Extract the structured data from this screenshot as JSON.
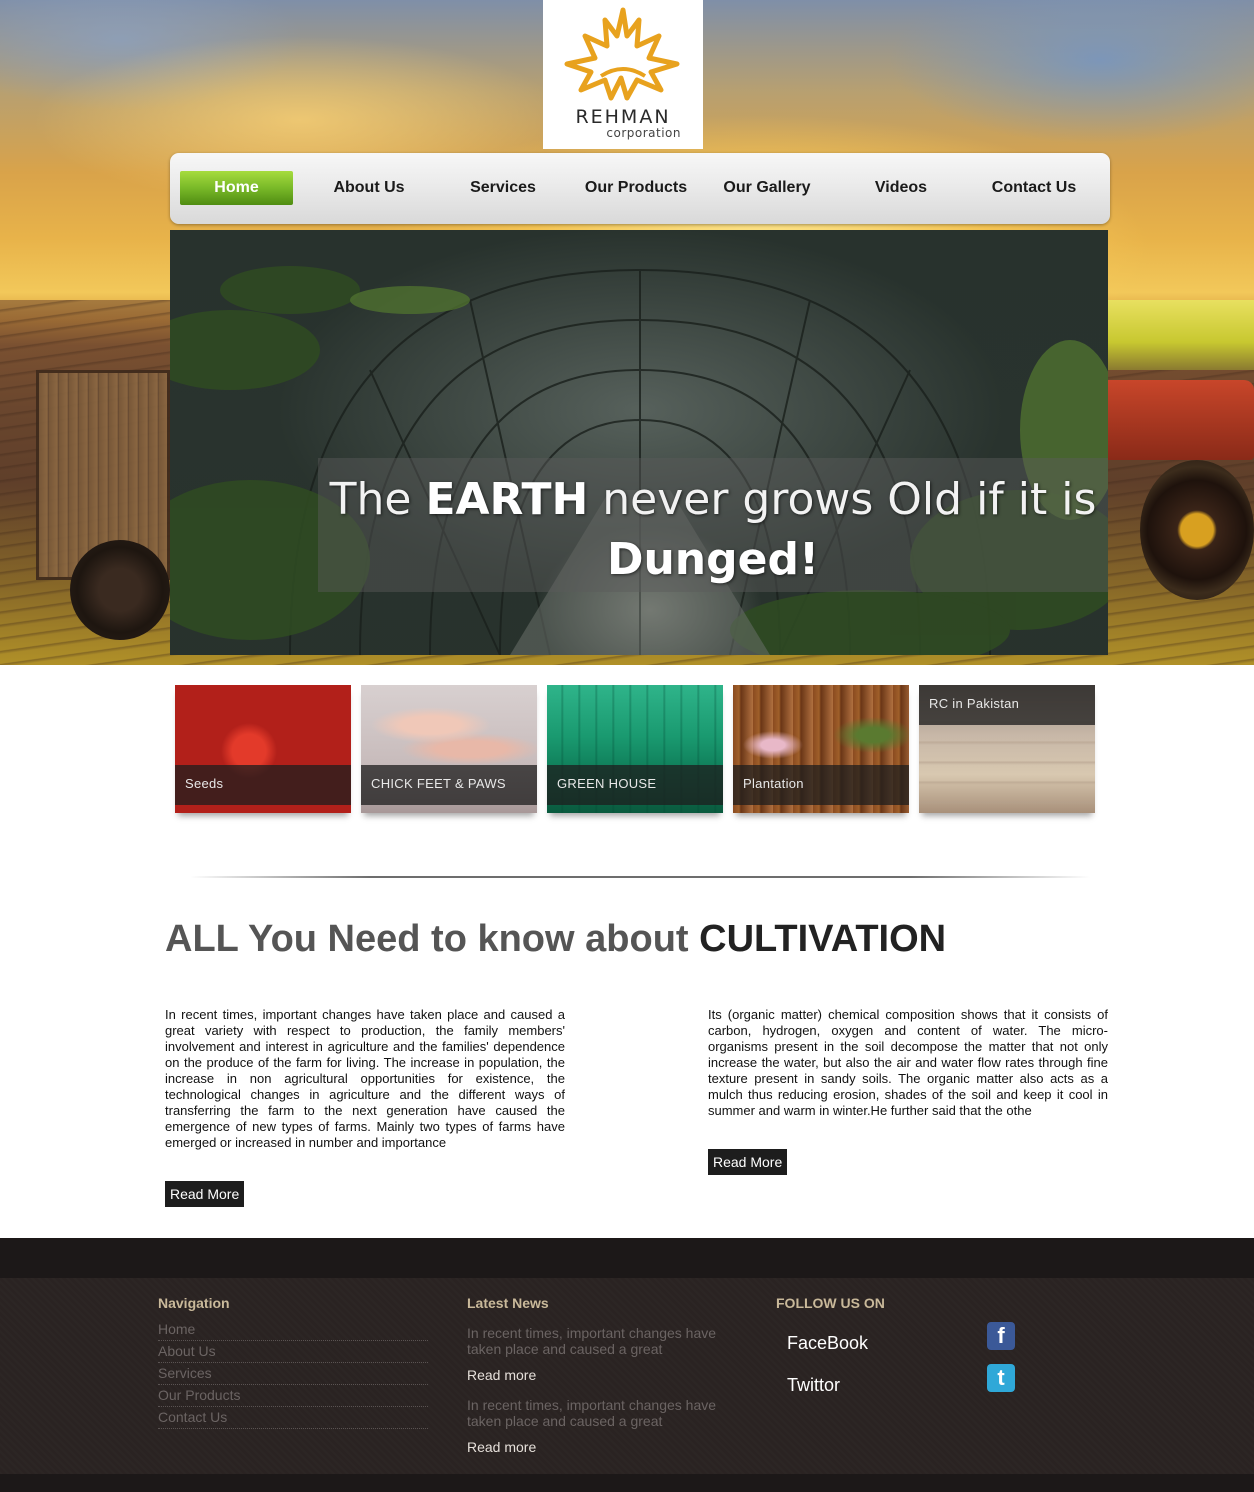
{
  "brand": {
    "name": "REHMAN",
    "tagline": "corporation",
    "colors": {
      "logo": "#e8a21e",
      "nav_active": "#79b928",
      "footer_bg": "#2a2322"
    }
  },
  "nav": {
    "items": [
      {
        "label": "Home",
        "active": true
      },
      {
        "label": "About Us",
        "active": false
      },
      {
        "label": "Services",
        "active": false
      },
      {
        "label": "Our Products",
        "active": false
      },
      {
        "label": "Our Gallery",
        "active": false
      },
      {
        "label": "Videos",
        "active": false
      },
      {
        "label": "Contact Us",
        "active": false
      }
    ]
  },
  "banner": {
    "caption_part1": "The ",
    "caption_bold1": "EARTH",
    "caption_part2": " never grows Old if it is ",
    "caption_bold2": "Dunged!"
  },
  "thumbs": [
    {
      "label": "Seeds"
    },
    {
      "label": "CHICK FEET & PAWS"
    },
    {
      "label": "GREEN HOUSE"
    },
    {
      "label": "Plantation"
    },
    {
      "label": "RC in Pakistan"
    }
  ],
  "main": {
    "heading_light": "ALL You Need to know about ",
    "heading_strong": "CULTIVATION",
    "col1_text": "In recent times, important changes have taken place and caused a great variety with respect to production, the family members' involvement and interest in agriculture and the families' dependence on the produce of the farm for living. The increase in population, the increase in non agricultural opportunities for existence, the technological changes in agriculture and the different ways of transferring the farm to the next generation have caused the emergence of new types of farms. Mainly two types of farms have emerged or increased in number and importance",
    "col2_text": "Its (organic matter) chemical composition shows that it consists of carbon, hydrogen, oxygen and content of water. The micro-organisms present in the soil decompose the matter that not only increase the water, but also the air and water flow rates through fine texture present in sandy soils. The organic matter also acts as a mulch thus reducing erosion, shades of the soil and keep it cool in summer and warm in winter.He further said that the othe",
    "read_more": "Read More"
  },
  "footer": {
    "nav_title": "Navigation",
    "nav_links": [
      "Home",
      "About Us",
      "Services",
      "Our Products",
      "Contact Us"
    ],
    "news_title": "Latest News",
    "news": [
      {
        "text": "In recent times, important changes have taken place and caused a great",
        "more": "Read more"
      },
      {
        "text": "In recent times, important changes have taken place and caused a great",
        "more": "Read more"
      }
    ],
    "follow_title": "FOLLOW US ON",
    "social": [
      {
        "label": "FaceBook",
        "icon": "facebook-icon",
        "color": "#3b5998"
      },
      {
        "label": "Twittor",
        "icon": "twitter-icon",
        "color": "#2fa8d8"
      }
    ]
  }
}
